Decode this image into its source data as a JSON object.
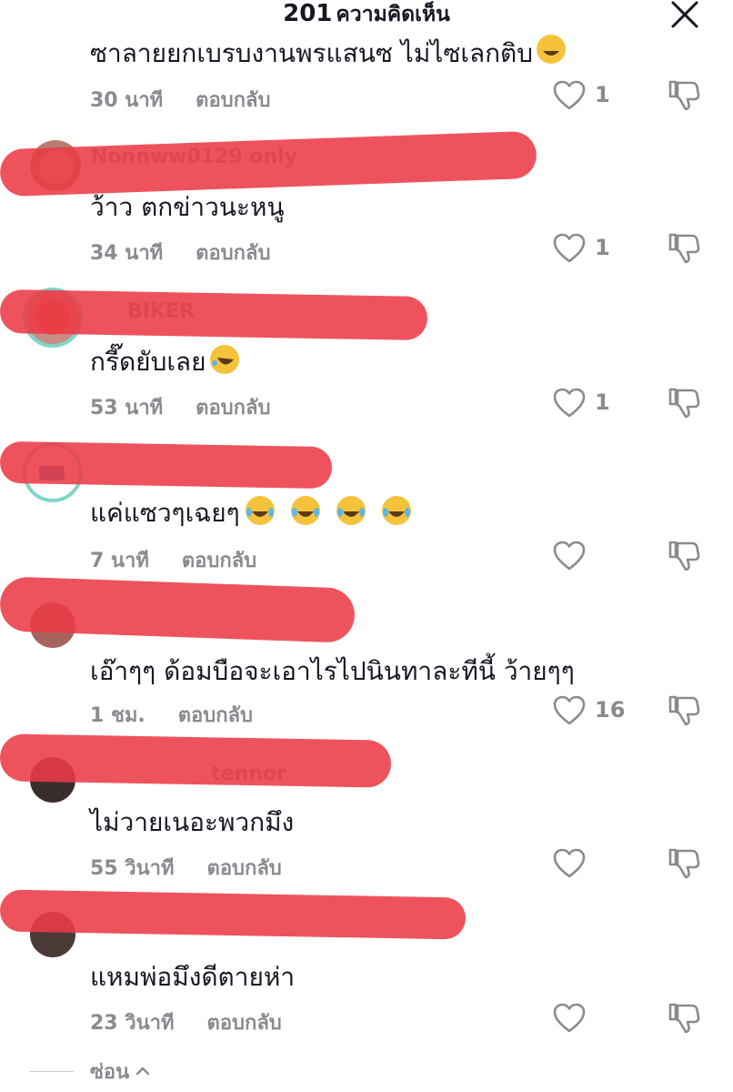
{
  "header": {
    "count": "201",
    "title": "ความคิดเห็น"
  },
  "top_partial": {
    "text": "ซาลายยกเบรบงานพรแสนซ ไม่ไซเลกติบ",
    "time": "30 นาที",
    "reply": "ตอบกลับ",
    "likes": "1"
  },
  "comments": [
    {
      "username": "Nonnww0129 only",
      "text": "ว้าว ตกข่าวนะหนู",
      "time": "34 นาที",
      "reply": "ตอบกลับ",
      "likes": "1"
    },
    {
      "username": "BIKER",
      "text": "กรี๊ดยับเลย",
      "time": "53 นาที",
      "reply": "ตอบกลับ",
      "likes": "1"
    },
    {
      "username": "",
      "text": "แค่แซวๆเฉยๆ",
      "time": "7 นาที",
      "reply": "ตอบกลับ",
      "likes": ""
    },
    {
      "username": "",
      "text": "เอ๊าๆๆ ด้อมบือจะเอาไรไปนินทาละทีนี้ ว้ายๆๆ",
      "time": "1 ชม.",
      "reply": "ตอบกลับ",
      "likes": "16"
    },
    {
      "username": "tennor",
      "text": "ไม่วายเนอะพวกมึง",
      "time": "55 วินาที",
      "reply": "ตอบกลับ",
      "likes": ""
    },
    {
      "username": "",
      "text": "แหมพ่อมึงดีตายห่า",
      "time": "23 วินาที",
      "reply": "ตอบกลับ",
      "likes": ""
    }
  ],
  "footer": {
    "collapse_label": "ซ่อน"
  },
  "colors": {
    "text": "#161823",
    "muted": "#8a8b91",
    "redaction": "#ec3b47"
  }
}
